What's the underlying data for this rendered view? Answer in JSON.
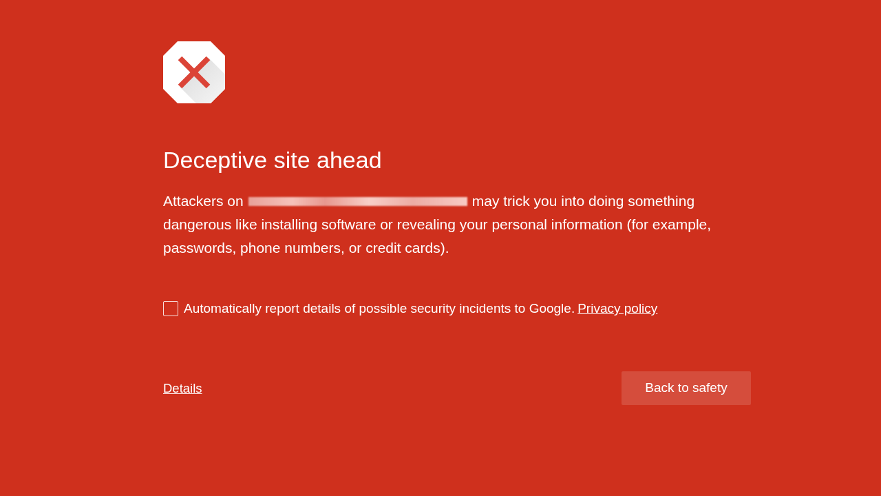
{
  "page": {
    "title": "Deceptive site ahead",
    "message": {
      "before_url": "Attackers on",
      "url_redacted": true,
      "after_url": "may trick you into doing something",
      "continued": "dangerous like installing software or revealing your personal information (for example, passwords, phone numbers, or credit cards)."
    },
    "report_option": {
      "label": "Automatically report details of possible security incidents to Google.",
      "link": "Privacy policy",
      "checked": false
    },
    "details_link": "Details",
    "buttons": [
      "Back to safety"
    ]
  }
}
